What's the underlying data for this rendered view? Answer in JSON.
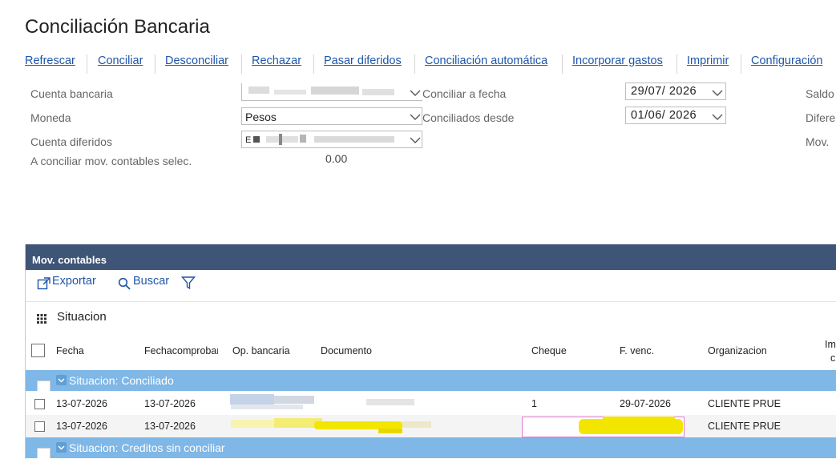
{
  "page_title": "Conciliación Bancaria",
  "toolbar": {
    "items": [
      "Refrescar",
      "Conciliar",
      "Desconciliar",
      "Rechazar",
      "Pasar diferidos",
      "Conciliación automática",
      "Incorporar gastos",
      "Imprimir",
      "Configuración"
    ]
  },
  "form": {
    "cuenta_bancaria_label": "Cuenta bancaria",
    "moneda_label": "Moneda",
    "moneda_value": "Pesos",
    "cuenta_diferidos_label": "Cuenta diferidos",
    "cuenta_diferidos_value": "E",
    "a_conciliar_label": "A conciliar mov. contables selec.",
    "a_conciliar_value": "0.00",
    "conciliar_fecha_label": "Conciliar a fecha",
    "conciliar_fecha_value": "29/07/ 2026",
    "conciliados_desde_label": "Conciliados desde",
    "conciliados_desde_value": "01/06/ 2026",
    "right_labels": [
      "Saldo",
      "Difere",
      "Mov."
    ]
  },
  "grid": {
    "header": "Mov. contables",
    "export_label": "Exportar",
    "search_label": "Buscar",
    "group_label": "Situacion",
    "columns": [
      "Fecha",
      "Fechacomprobar",
      "Op. bancaria",
      "Documento",
      "Cheque",
      "F. venc.",
      "Organizacion",
      "Im",
      "c"
    ],
    "group1": "Situacion: Conciliado",
    "group2": "Situacion: Creditos sin conciliar",
    "rows": [
      {
        "fecha": "13-07-2026",
        "fechacomp": "13-07-2026",
        "cheque": "1",
        "fvenc": "29-07-2026",
        "organizacion": "CLIENTE PRUE"
      },
      {
        "fecha": "13-07-2026",
        "fechacomp": "13-07-2026",
        "cheque": "",
        "fvenc": "",
        "organizacion": "CLIENTE PRUE"
      }
    ]
  },
  "colors": {
    "link": "#1f56a8",
    "grid_header": "#3f5577",
    "group_band": "#7fb7e6",
    "highlight": "#f2e600",
    "selection_border": "#e27ad0"
  }
}
